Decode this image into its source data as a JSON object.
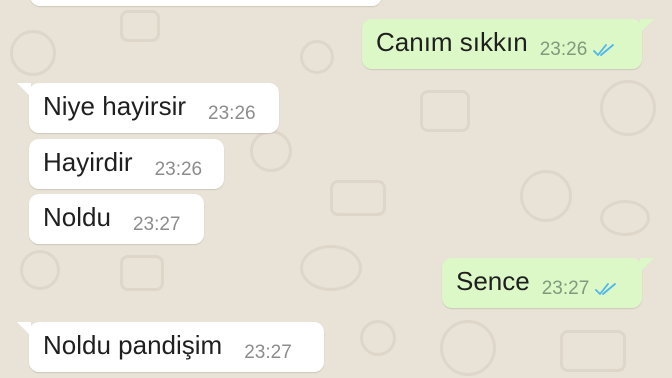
{
  "messages": [
    {
      "text": "Canım sıkkın",
      "time": "23:26",
      "direction": "outgoing",
      "status": "read"
    },
    {
      "text": "Niye hayirsir",
      "time": "23:26",
      "direction": "incoming"
    },
    {
      "text": "Hayirdir",
      "time": "23:26",
      "direction": "incoming"
    },
    {
      "text": "Noldu",
      "time": "23:27",
      "direction": "incoming"
    },
    {
      "text": "Sence",
      "time": "23:27",
      "direction": "outgoing",
      "status": "read"
    },
    {
      "text": "Noldu pandişim",
      "time": "23:27",
      "direction": "incoming"
    }
  ],
  "colors": {
    "chat_background": "#e9e2d6",
    "incoming_bubble": "#ffffff",
    "outgoing_bubble": "#dcf8c6",
    "read_ticks": "#4fb6ec",
    "timestamp": "#8c8c8c"
  },
  "icons": {
    "read_receipt": "double-check-icon"
  }
}
